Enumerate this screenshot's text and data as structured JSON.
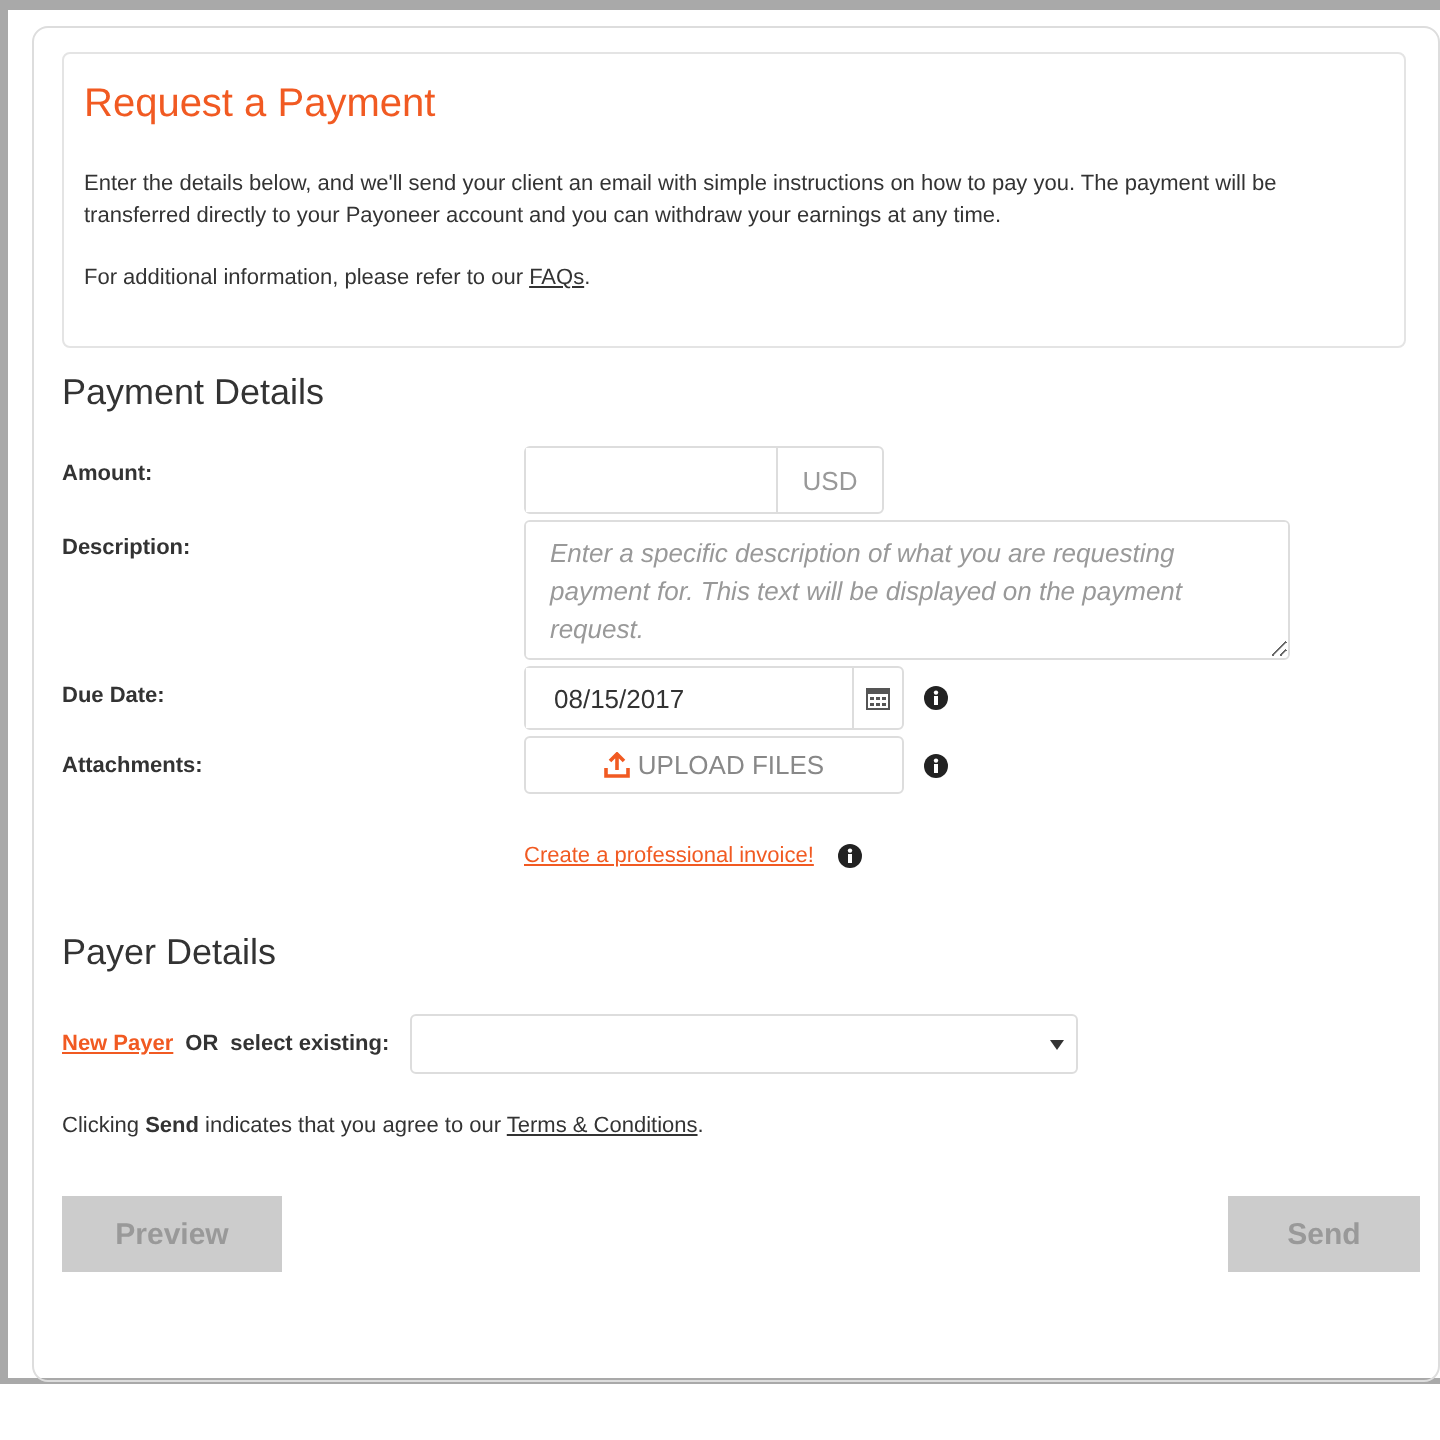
{
  "intro": {
    "title": "Request a Payment",
    "paragraphs": [
      "Enter the details below, and we'll send your client an email with simple instructions on how to pay you. The payment will be transferred directly to your Payoneer account and you can withdraw your earnings at any time."
    ],
    "faq_line": {
      "before": "For additional information, please refer to our ",
      "link": "FAQs",
      "after": "."
    }
  },
  "payment_details": {
    "heading": "Payment Details",
    "fields": [
      {
        "kind": "amount",
        "label": "Amount:",
        "currency": "USD"
      },
      {
        "kind": "textarea",
        "label": "Description:",
        "placeholder": "Enter a specific description of what you are requesting payment for. This text will be displayed on the payment request."
      },
      {
        "kind": "date",
        "label": "Due Date:",
        "value": "08/15/2017"
      },
      {
        "kind": "upload",
        "label": "Attachments:",
        "button": "UPLOAD FILES"
      }
    ],
    "invoice_link": "Create a professional invoice!"
  },
  "payer_details": {
    "heading": "Payer Details",
    "new_payer": "New Payer",
    "or": "OR",
    "select_label": "select existing:",
    "terms": {
      "before": "Clicking **Send** indicates that you agree to our ",
      "link": "Terms & Conditions",
      "after": "."
    }
  },
  "buttons": [
    {
      "label": "Preview",
      "disabled": true
    },
    {
      "label": "Send",
      "disabled": true
    }
  ]
}
